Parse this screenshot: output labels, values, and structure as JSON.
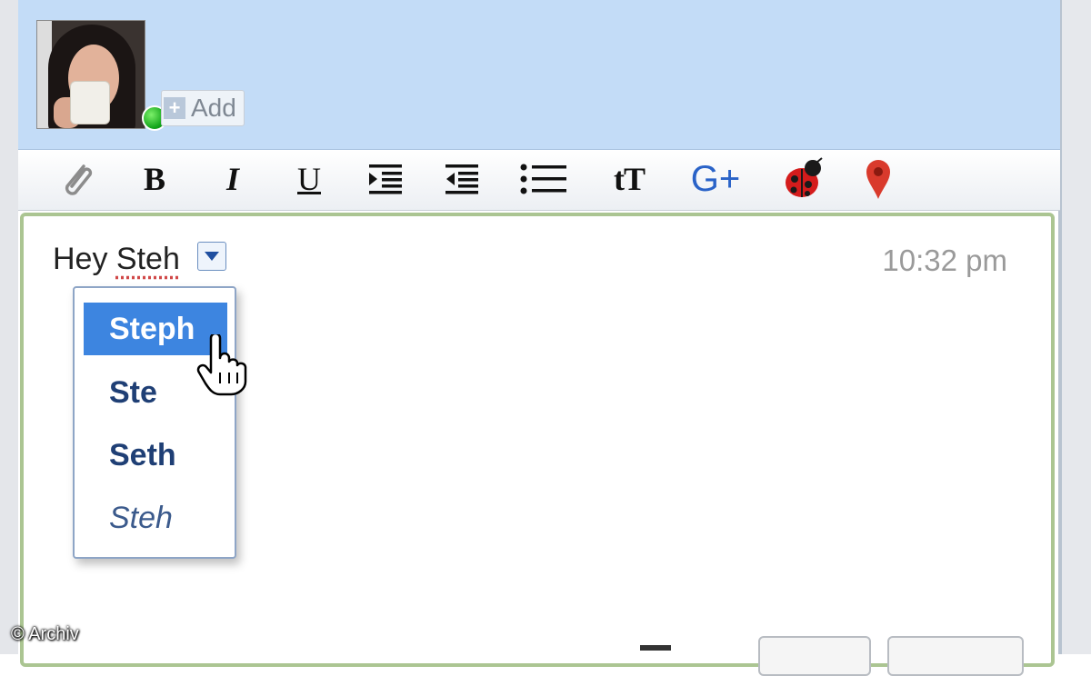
{
  "header": {
    "add_label": "Add",
    "presence_color": "#1fb32a"
  },
  "toolbar": {
    "buttons": [
      {
        "name": "attach",
        "icon": "paperclip-icon"
      },
      {
        "name": "bold",
        "label": "B"
      },
      {
        "name": "italic",
        "label": "I"
      },
      {
        "name": "underline",
        "label": "U"
      },
      {
        "name": "indent",
        "icon": "indent-icon"
      },
      {
        "name": "outdent",
        "icon": "outdent-icon"
      },
      {
        "name": "bullets",
        "icon": "bullet-list-icon"
      },
      {
        "name": "font-size",
        "label": "tT"
      },
      {
        "name": "google-plus",
        "label": "G+"
      },
      {
        "name": "ladybug",
        "icon": "ladybug-icon"
      },
      {
        "name": "map-pin",
        "icon": "map-pin-icon"
      }
    ]
  },
  "message": {
    "prefix": "Hey ",
    "misspelled_word": "Steh",
    "timestamp": "10:32 pm"
  },
  "suggestions": {
    "items": [
      "Steph",
      "Ste",
      "Seth",
      "Steh"
    ],
    "selected_index": 0
  },
  "watermark": "© Archiv",
  "colors": {
    "header_bg": "#c3dcf7",
    "selection": "#3d85e0",
    "compose_border": "#abc592"
  }
}
